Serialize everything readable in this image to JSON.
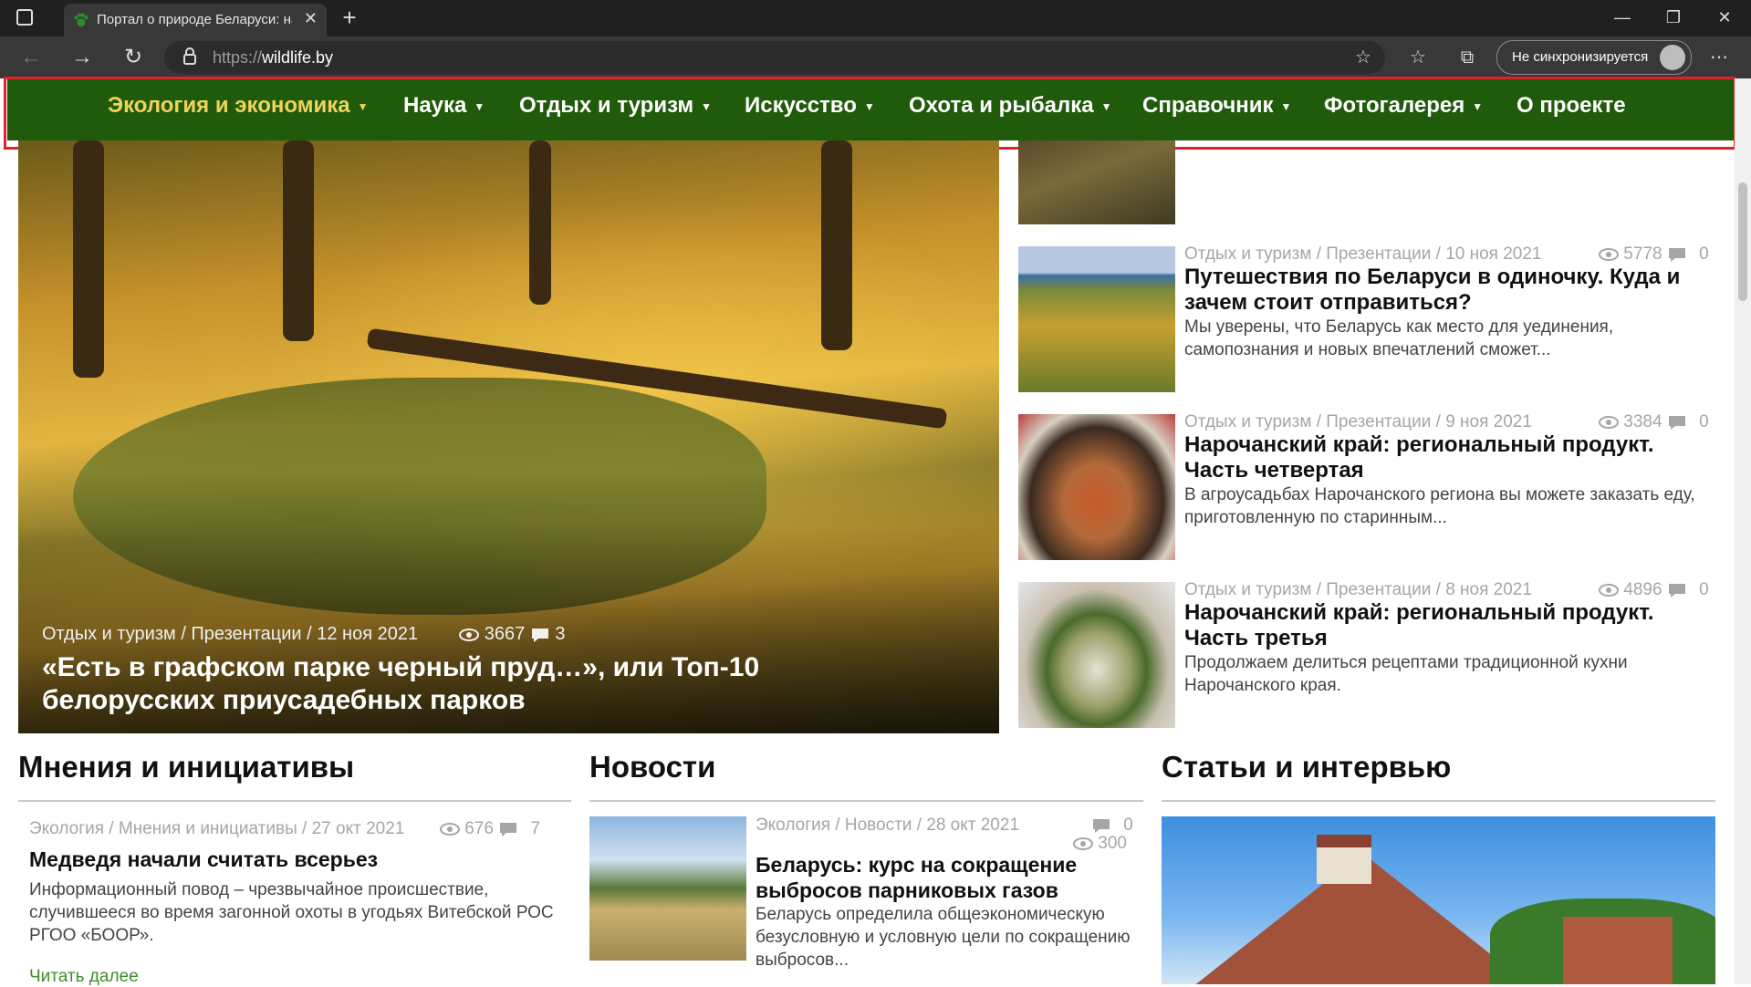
{
  "browser": {
    "tab_title": "Портал о природе Беларуси: на",
    "url_scheme": "https://",
    "url_host": "wildlife.by",
    "sync_label": "Не синхронизируется"
  },
  "nav": {
    "items": [
      {
        "label": "Экология и экономика",
        "caret": true,
        "active": true
      },
      {
        "label": "Наука",
        "caret": true
      },
      {
        "label": "Отдых и туризм",
        "caret": true
      },
      {
        "label": "Искусство",
        "caret": true
      },
      {
        "label": "Охота и рыбалка",
        "caret": true
      },
      {
        "label": "Справочник",
        "caret": true
      },
      {
        "label": "Фотогалерея",
        "caret": true
      },
      {
        "label": "О проекте",
        "caret": false
      }
    ],
    "active_color": "#f1d35a",
    "bg_color": "#1f5b0b"
  },
  "hero": {
    "meta": "Отдых и туризм / Презентации / 12 ноя 2021",
    "views": "3667",
    "comments": "3",
    "title": "«Есть в графском парке черный пруд…», или Топ-10 белорусских приусадебных парков"
  },
  "right_list": [
    {
      "meta": "Отдых и туризм / Презентации / 10 ноя 2021",
      "views": "5778",
      "comments": "0",
      "title": "Путешествия по Беларуси в одиночку. Куда и зачем стоит отправиться?",
      "excerpt": "Мы уверены, что Беларусь как место для уединения, самопознания и новых впечатлений сможет..."
    },
    {
      "meta": "Отдых и туризм / Презентации / 9 ноя 2021",
      "views": "3384",
      "comments": "0",
      "title": "Нарочанский край: региональный продукт. Часть четвертая",
      "excerpt": "В агроусадьбах Нарочанского региона вы можете заказать еду, приготовленную по старинным..."
    },
    {
      "meta": "Отдых и туризм / Презентации / 8 ноя 2021",
      "views": "4896",
      "comments": "0",
      "title": "Нарочанский край: региональный продукт. Часть третья",
      "excerpt": "Продолжаем делиться рецептами традиционной кухни Нарочанского края."
    }
  ],
  "columns": {
    "opinions": {
      "heading": "Мнения и инициативы",
      "meta": "Экология / Мнения и инициативы / 27 окт 2021",
      "views": "676",
      "comments": "7",
      "title": "Медведя начали считать всерьез",
      "excerpt": "Информационный повод – чрезвычайное происшествие, случившееся во время загонной охоты в угодьях Витебской РОС РГОО «БООР».",
      "read_more": "Читать далее"
    },
    "news": {
      "heading": "Новости",
      "meta": "Экология / Новости / 28 окт 2021",
      "comments": "0",
      "views": "300",
      "title": "Беларусь: курс на сокращение выбросов парниковых газов",
      "excerpt": "Беларусь определила общеэкономическую безусловную и условную цели по сокращению выбросов..."
    },
    "articles": {
      "heading": "Статьи и интервью"
    }
  }
}
